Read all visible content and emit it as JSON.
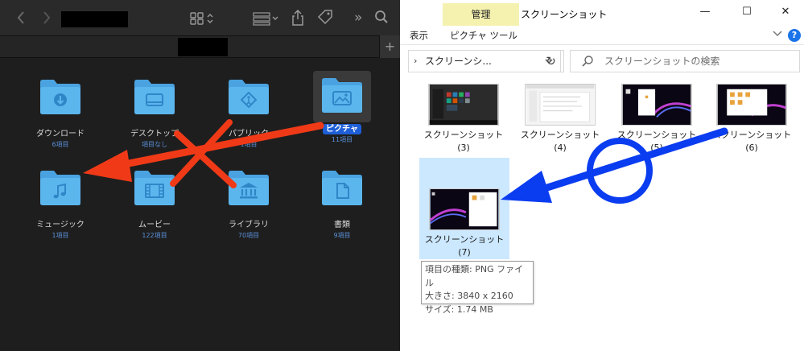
{
  "mac_finder": {
    "folders": [
      {
        "name": "ダウンロード",
        "count": "6項目",
        "icon": "arrow-down-circle-icon"
      },
      {
        "name": "デスクトップ",
        "count": "項目なし",
        "icon": "desktop-icon"
      },
      {
        "name": "パブリック",
        "count": "1項目",
        "icon": "public-icon"
      },
      {
        "name": "ピクチャ",
        "count": "11項目",
        "icon": "photo-icon",
        "selected": true
      },
      {
        "name": "ミュージック",
        "count": "1項目",
        "icon": "music-note-icon"
      },
      {
        "name": "ムービー",
        "count": "122項目",
        "icon": "film-icon"
      },
      {
        "name": "ライブラリ",
        "count": "70項目",
        "icon": "library-icon"
      },
      {
        "name": "書類",
        "count": "9項目",
        "icon": "document-icon"
      }
    ],
    "plus_label": "+"
  },
  "windows_explorer": {
    "context_tab": "管理",
    "title": "スクリーンショット",
    "window_controls": {
      "minimize": "—",
      "maximize": "☐",
      "close": "✕"
    },
    "ribbon_tabs": [
      "表示",
      "ピクチャ ツール"
    ],
    "address": "スクリーンシ...",
    "search_placeholder": "スクリーンショットの検索",
    "items": [
      {
        "name": "スクリーンショット",
        "num": "(3)"
      },
      {
        "name": "スクリーンショット",
        "num": "(4)"
      },
      {
        "name": "スクリーンショット",
        "num": "(5)"
      },
      {
        "name": "スクリーンショット",
        "num": "(6)"
      },
      {
        "name": "スクリーンショット",
        "num": "(7)",
        "selected": true
      }
    ],
    "tooltip": {
      "type": "項目の種類: PNG ファイル",
      "size": "大きさ: 3840 x 2160",
      "filesize": "サイズ: 1.74 MB"
    }
  },
  "colors": {
    "mac_bg": "#1e1e1e",
    "folder_blue": "#5cb6ee",
    "selection_blue": "#1e5fd8",
    "annotation_red": "#f03a17",
    "annotation_blue": "#0a3cf0",
    "tooltip_bg": "#ffffff"
  }
}
